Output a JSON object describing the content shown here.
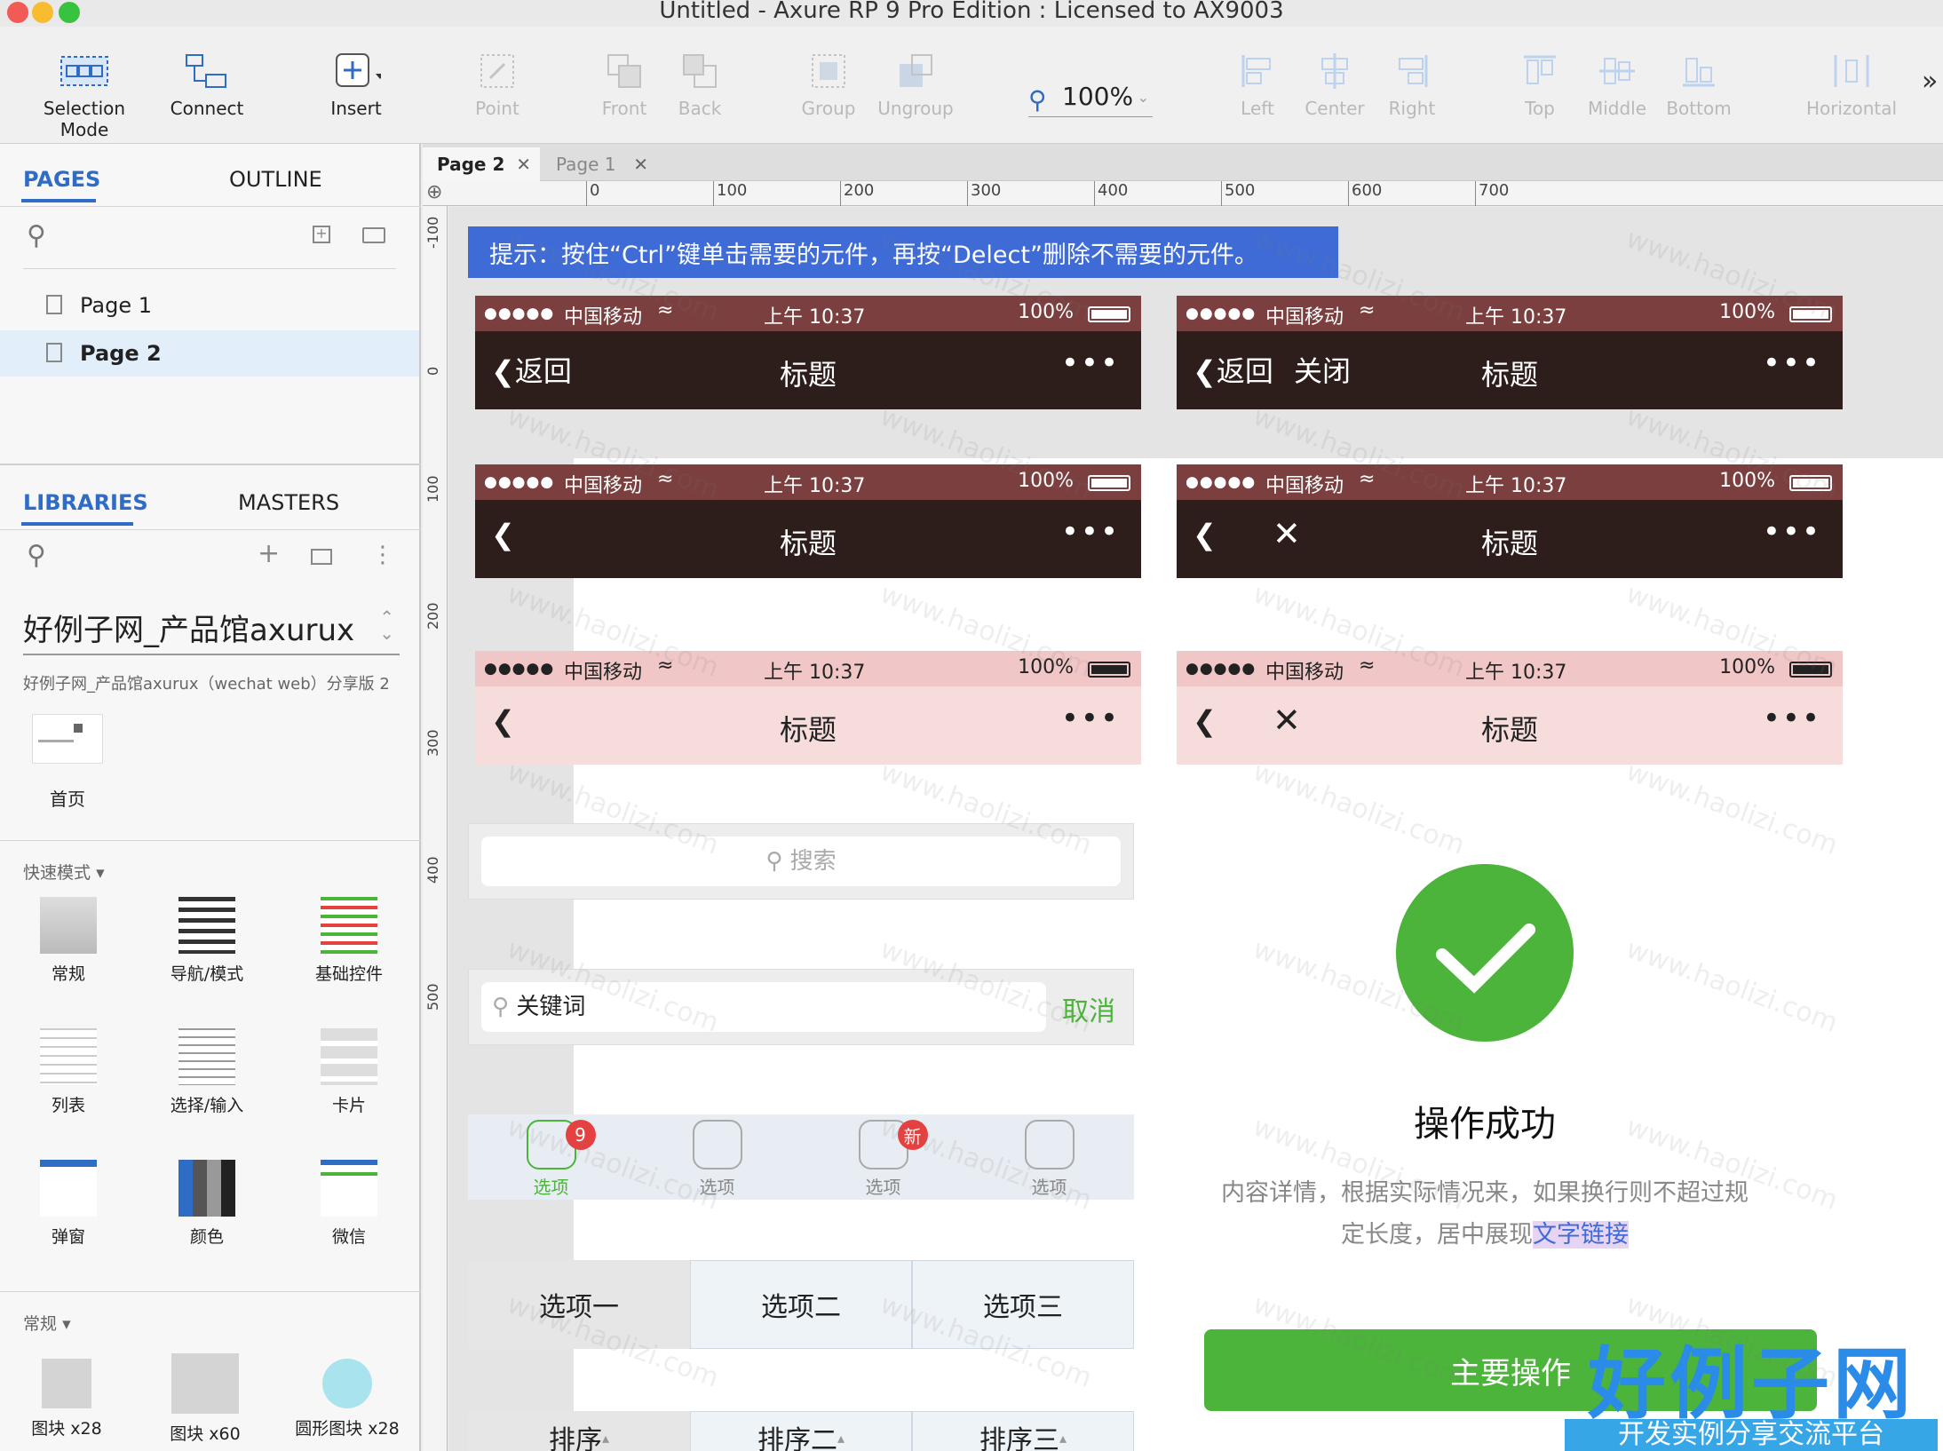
{
  "window": {
    "title": "Untitled - Axure RP 9 Pro Edition : Licensed to AX9003"
  },
  "toolbar": {
    "items": [
      {
        "label": "Selection Mode",
        "icon": "selection-mode-icon",
        "enabled": true
      },
      {
        "label": "Connect",
        "icon": "connect-icon",
        "enabled": true
      },
      {
        "label": "Insert",
        "icon": "insert-icon",
        "enabled": true
      },
      {
        "label": "Point",
        "icon": "point-icon",
        "enabled": false
      },
      {
        "label": "Front",
        "icon": "front-icon",
        "enabled": false
      },
      {
        "label": "Back",
        "icon": "back-icon",
        "enabled": false
      },
      {
        "label": "Group",
        "icon": "group-icon",
        "enabled": false
      },
      {
        "label": "Ungroup",
        "icon": "ungroup-icon",
        "enabled": false
      },
      {
        "label": "Left",
        "icon": "align-left-icon",
        "enabled": false
      },
      {
        "label": "Center",
        "icon": "align-center-icon",
        "enabled": false
      },
      {
        "label": "Right",
        "icon": "align-right-icon",
        "enabled": false
      },
      {
        "label": "Top",
        "icon": "align-top-icon",
        "enabled": false
      },
      {
        "label": "Middle",
        "icon": "align-middle-icon",
        "enabled": false
      },
      {
        "label": "Bottom",
        "icon": "align-bottom-icon",
        "enabled": false
      },
      {
        "label": "Horizontal",
        "icon": "distribute-horizontal-icon",
        "enabled": false
      }
    ],
    "zoom": "100%",
    "overflow": "»"
  },
  "pages_panel": {
    "tabs": [
      "PAGES",
      "OUTLINE"
    ],
    "active_tab": "PAGES",
    "pages": [
      "Page 1",
      "Page 2"
    ],
    "selected": "Page 2"
  },
  "libraries_panel": {
    "tabs": [
      "LIBRARIES",
      "MASTERS"
    ],
    "active_tab": "LIBRARIES",
    "library_name": "好例子网_产品馆axurux",
    "library_desc": "好例子网_产品馆axurux（wechat web）分享版 2",
    "home_label": "首页",
    "quick_mode": "快速模式",
    "quick_items": [
      "常规",
      "导航/模式",
      "基础控件",
      "列表",
      "选择/输入",
      "卡片",
      "弹窗",
      "颜色",
      "微信"
    ],
    "general": "常规",
    "general_items": [
      "图块 x28",
      "图块 x60",
      "圆形图块 x28"
    ]
  },
  "doc_tabs": [
    {
      "label": "Page 2",
      "active": true
    },
    {
      "label": "Page 1",
      "active": false
    }
  ],
  "ruler": {
    "h_ticks": [
      "0",
      "100",
      "200",
      "300",
      "400",
      "500",
      "600",
      "700"
    ],
    "v_ticks": [
      "-100",
      "0",
      "100",
      "200",
      "300",
      "400",
      "500"
    ]
  },
  "canvas": {
    "hint": "提示：按住“Ctrl”键单击需要的元件，再按“Delect”删除不需要的元件。",
    "status": {
      "carrier": "中国移动",
      "time": "上午 10:37",
      "battery": "100%"
    },
    "nav_title": "标题",
    "back_label": "返回",
    "close_label": "关闭",
    "more": "•••",
    "search_placeholder": "搜索",
    "search_keyword": "关键词",
    "cancel": "取消",
    "tab_label": "选项",
    "badge_num": "9",
    "badge_new": "新",
    "segments": [
      "选项一",
      "选项二",
      "选项三"
    ],
    "sort_labels": [
      "排序",
      "排序二",
      "排序三"
    ],
    "success_title": "操作成功",
    "success_desc_1": "内容详情，根据实际情况来，如果换行则不超过规",
    "success_desc_2": "定长度，居中展现",
    "success_link": "文字链接",
    "primary_button": "主要操作",
    "colors": {
      "dark_status": "#7a3f3e",
      "dark_bar": "#2d1d1b",
      "pink_status": "#f0c6c6",
      "pink_bar": "#f7dcdc",
      "green": "#4cb43b",
      "hint": "#3f6bd6"
    }
  },
  "watermark": {
    "title": "好例子网",
    "subtitle": "开发实例分享交流平台",
    "repeat": "www.haolizi.com"
  }
}
